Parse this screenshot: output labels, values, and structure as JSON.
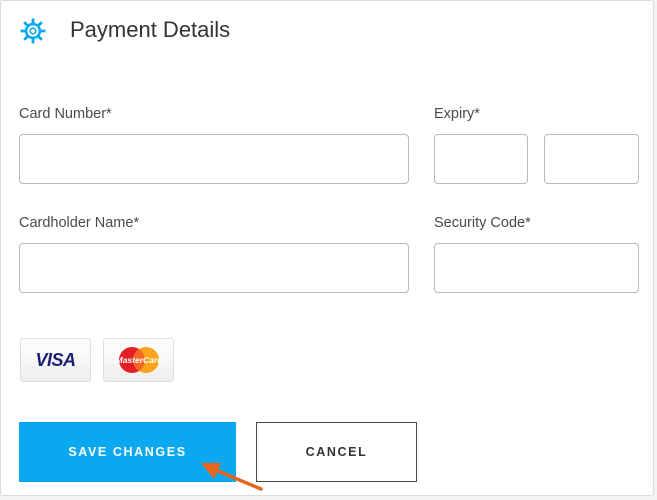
{
  "header": {
    "title": "Payment Details",
    "icon": "gear-icon"
  },
  "form": {
    "card_number_label": "Card Number*",
    "expiry_label": "Expiry*",
    "cardholder_label": "Cardholder Name*",
    "security_code_label": "Security Code*",
    "card_number_value": "",
    "expiry_month_value": "",
    "expiry_year_value": "",
    "cardholder_value": "",
    "security_code_value": ""
  },
  "cards": {
    "visa_label": "VISA",
    "mastercard_label": "MasterCard"
  },
  "actions": {
    "save_label": "SAVE CHANGES",
    "cancel_label": "CANCEL"
  },
  "colors": {
    "accent": "#0aa8f0",
    "arrow": "#e8651e"
  }
}
